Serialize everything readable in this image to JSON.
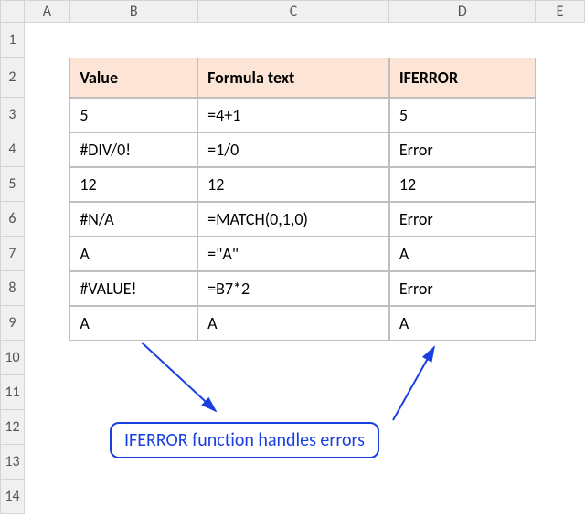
{
  "columns": {
    "rowhdr": "",
    "A": "A",
    "B": "B",
    "C": "C",
    "D": "D",
    "E": "E"
  },
  "row_labels": [
    "1",
    "2",
    "3",
    "4",
    "5",
    "6",
    "7",
    "8",
    "9",
    "10",
    "11",
    "12",
    "13",
    "14"
  ],
  "table": {
    "headers": {
      "value": "Value",
      "formula_text": "Formula text",
      "iferror": "IFERROR"
    },
    "rows": [
      {
        "value": "5",
        "formula_text": "=4+1",
        "iferror": "5"
      },
      {
        "value": "#DIV/0!",
        "formula_text": "=1/0",
        "iferror": "Error"
      },
      {
        "value": "12",
        "formula_text": "12",
        "iferror": "12"
      },
      {
        "value": "#N/A",
        "formula_text": "=MATCH(0,1,0)",
        "iferror": "Error"
      },
      {
        "value": "A",
        "formula_text": "=\"A\"",
        "iferror": "A"
      },
      {
        "value": "#VALUE!",
        "formula_text": "=B7*2",
        "iferror": "Error"
      },
      {
        "value": "A",
        "formula_text": "A",
        "iferror": "A"
      }
    ]
  },
  "callout": {
    "text": "IFERROR function handles errors"
  }
}
